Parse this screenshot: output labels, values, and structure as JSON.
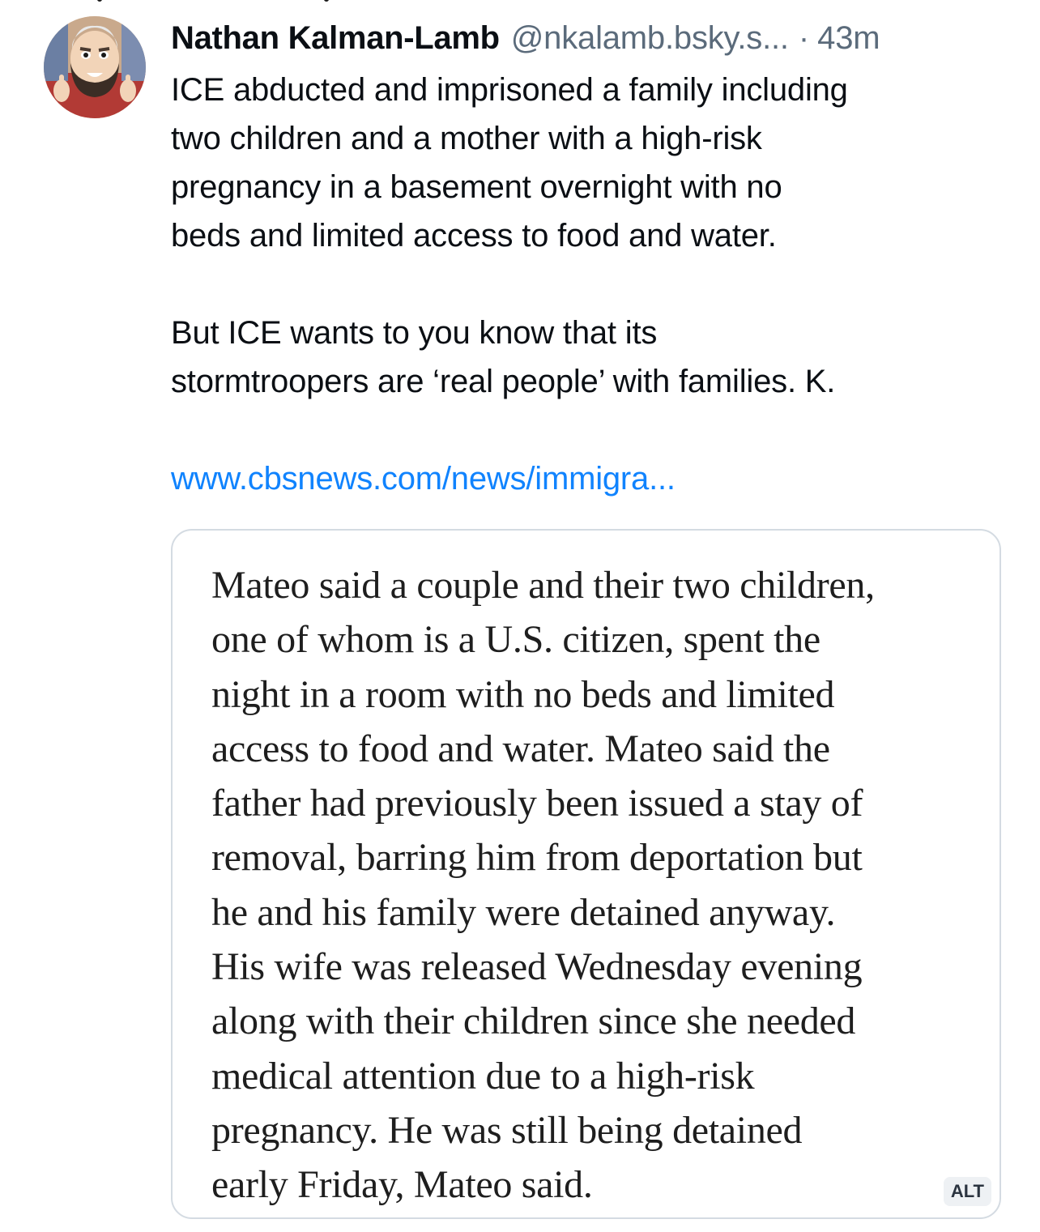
{
  "post": {
    "display_name": "Nathan Kalman-Lamb",
    "handle": "@nkalamb.bsky.s...",
    "separator": "·",
    "time": "43m",
    "text_lines": [
      "ICE abducted and imprisoned a family including",
      "two children and a mother with a high-risk",
      "pregnancy in a basement overnight with no",
      "beds and limited access to food and water.",
      "But ICE wants to you know that its",
      "stormtroopers are ‘real people’ with families. K."
    ],
    "link_text": "www.cbsnews.com/news/immigra..."
  },
  "embed": {
    "quote_lines": [
      "Mateo said a couple and their two children,",
      "one of whom is a U.S. citizen, spent the",
      "night in a room with no beds and limited",
      "access to food and water. Mateo said the",
      "father had previously been issued a stay of",
      "removal, barring him from deportation but",
      "he and his family were detained anyway.",
      "His wife was released Wednesday evening",
      "along with their children since she needed",
      "medical attention due to a high-risk",
      "pregnancy. He was still being detained",
      "early Friday, Mateo said."
    ],
    "alt_label": "ALT"
  },
  "colors": {
    "link": "#1083fe",
    "muted": "#5b6b7b",
    "text": "#0b0f14",
    "embed_border": "#d4dbe2"
  },
  "icons": {
    "avatar": "avatar-cartoon-bearded-man"
  }
}
